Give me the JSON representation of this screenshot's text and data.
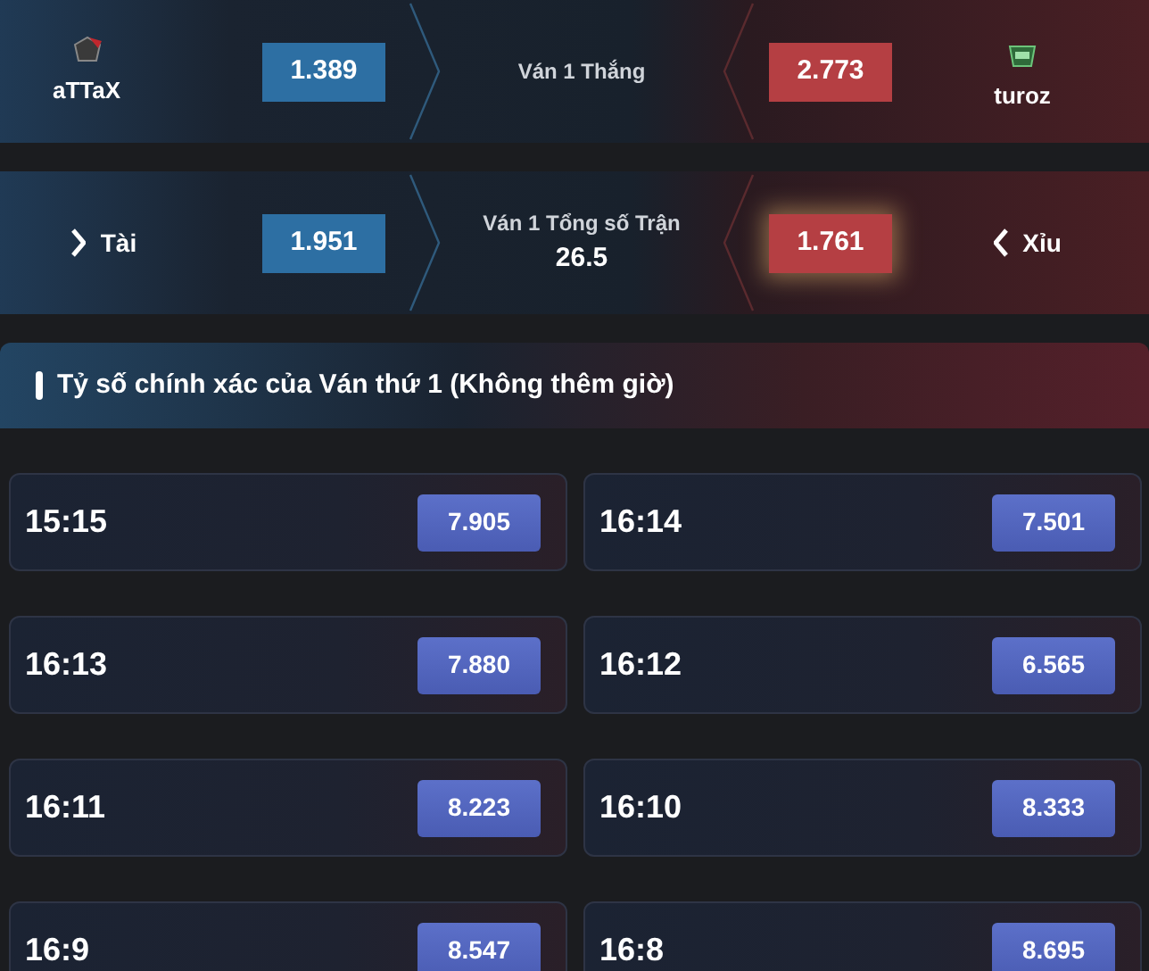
{
  "markets": [
    {
      "kind": "teams",
      "left": {
        "label": "aTTaX",
        "odds": "1.389",
        "selected": false
      },
      "center": {
        "title": "Ván 1 Thắng"
      },
      "right": {
        "label": "turoz",
        "odds": "2.773",
        "selected": false
      }
    },
    {
      "kind": "total",
      "left": {
        "label": "Tài",
        "odds": "1.951",
        "selected": false
      },
      "center": {
        "title": "Ván 1 Tổng số Trận",
        "line": "26.5"
      },
      "right": {
        "label": "Xỉu",
        "odds": "1.761",
        "selected": true
      }
    }
  ],
  "section": {
    "title": "Tỷ số chính xác của Ván thứ 1 (Không thêm giờ)",
    "scores": [
      {
        "score": "15:15",
        "odds": "7.905"
      },
      {
        "score": "16:14",
        "odds": "7.501"
      },
      {
        "score": "16:13",
        "odds": "7.880"
      },
      {
        "score": "16:12",
        "odds": "6.565"
      },
      {
        "score": "16:11",
        "odds": "8.223"
      },
      {
        "score": "16:10",
        "odds": "8.333"
      },
      {
        "score": "16:9",
        "odds": "8.547"
      },
      {
        "score": "16:8",
        "odds": "8.695"
      }
    ]
  }
}
